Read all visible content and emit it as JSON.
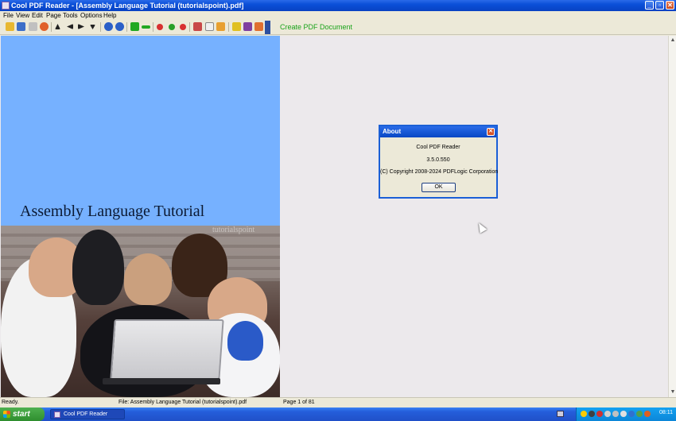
{
  "window": {
    "title": "Cool PDF Reader - [Assembly Language Tutorial (tutorialspoint).pdf]",
    "minimize_label": "_",
    "maximize_label": "▫",
    "close_label": "✕"
  },
  "menu": {
    "items": [
      "File",
      "View",
      "Edit",
      "Page",
      "Tools",
      "Options",
      "Help"
    ]
  },
  "toolbar": {
    "create_label": "Create PDF Document",
    "icons": [
      "open-icon",
      "save-icon",
      "print-icon",
      "info-icon",
      "arrow-up-icon",
      "arrow-left-icon",
      "arrow-right-icon",
      "arrow-down-icon",
      "undo-icon",
      "redo-icon",
      "zoom-in-icon",
      "zoom-out-icon",
      "stop-red-icon",
      "stop-green-icon",
      "stop-red2-icon",
      "tools-icon",
      "copy-icon",
      "edit-icon",
      "shield-icon",
      "book-icon",
      "image-icon"
    ]
  },
  "pdf": {
    "title": "Assembly Language Tutorial",
    "watermark": "tutorialspoint"
  },
  "about": {
    "title": "About",
    "close_label": "✕",
    "product": "Cool PDF Reader",
    "version": "3.5.0.550",
    "copyright": "(C) Copyright 2008-2024 PDFLogic Corporation",
    "ok_label": "OK"
  },
  "status": {
    "ready": "Ready.",
    "file": "File: Assembly Language Tutorial (tutorialspoint).pdf",
    "page": "Page 1 of 81"
  },
  "taskbar": {
    "start_label": "start",
    "task_label": "Cool PDF Reader",
    "clock": "08:11"
  },
  "colors": {
    "title_blue": "#0a4fd8",
    "pdf_cover": "#76b1ff",
    "create_green": "#19a219"
  }
}
